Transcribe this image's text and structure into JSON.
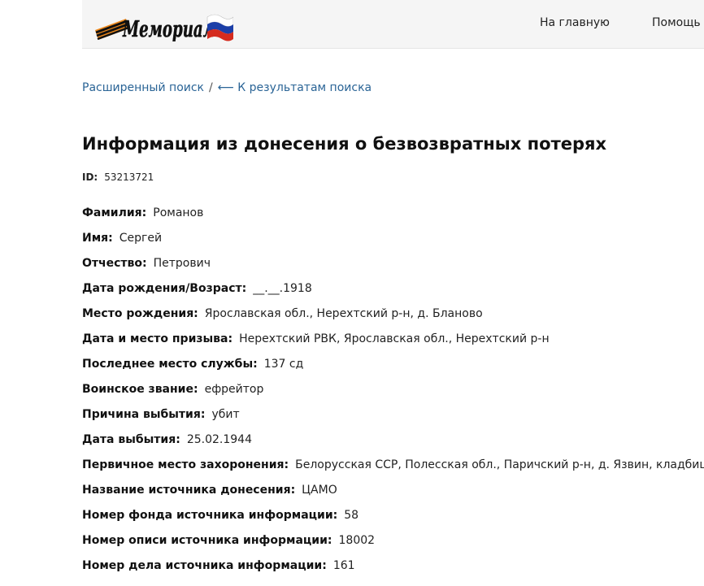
{
  "header": {
    "logo_text": "Мемориал",
    "nav": {
      "home": "На главную",
      "help": "Помощь"
    }
  },
  "breadcrumb": {
    "advanced_search": "Расширенный поиск",
    "separator": "/",
    "back_to_results": "⟵ К результатам поиска"
  },
  "page": {
    "title": "Информация из донесения о безвозвратных потерях",
    "id_label": "ID:",
    "id_value": "53213721"
  },
  "fields": [
    {
      "label": "Фамилия:",
      "value": "Романов"
    },
    {
      "label": "Имя:",
      "value": "Сергей"
    },
    {
      "label": "Отчество:",
      "value": "Петрович"
    },
    {
      "label": "Дата рождения/Возраст:",
      "value": "__.__.1918"
    },
    {
      "label": "Место рождения:",
      "value": "Ярославская обл., Нерехтский р-н, д. Бланово"
    },
    {
      "label": "Дата и место призыва:",
      "value": "Нерехтский РВК, Ярославская обл., Нерехтский р-н"
    },
    {
      "label": "Последнее место службы:",
      "value": "137 сд"
    },
    {
      "label": "Воинское звание:",
      "value": "ефрейтор"
    },
    {
      "label": "Причина выбытия:",
      "value": "убит"
    },
    {
      "label": "Дата выбытия:",
      "value": "25.02.1944"
    },
    {
      "label": "Первичное место захоронения:",
      "value": "Белорусская ССР, Полесская обл., Паричский р-н, д. Язвин, кладбище"
    },
    {
      "label": "Название источника донесения:",
      "value": "ЦАМО"
    },
    {
      "label": "Номер фонда источника информации:",
      "value": "58"
    },
    {
      "label": "Номер описи источника информации:",
      "value": "18002"
    },
    {
      "label": "Номер дела источника информации:",
      "value": "161"
    }
  ],
  "colors": {
    "link": "#2a6496",
    "header_bg": "#f5f5f5",
    "ribbon_orange": "#f08a1c",
    "flag_white": "#ffffff",
    "flag_blue": "#1c3fa8",
    "flag_red": "#d52b1e"
  }
}
